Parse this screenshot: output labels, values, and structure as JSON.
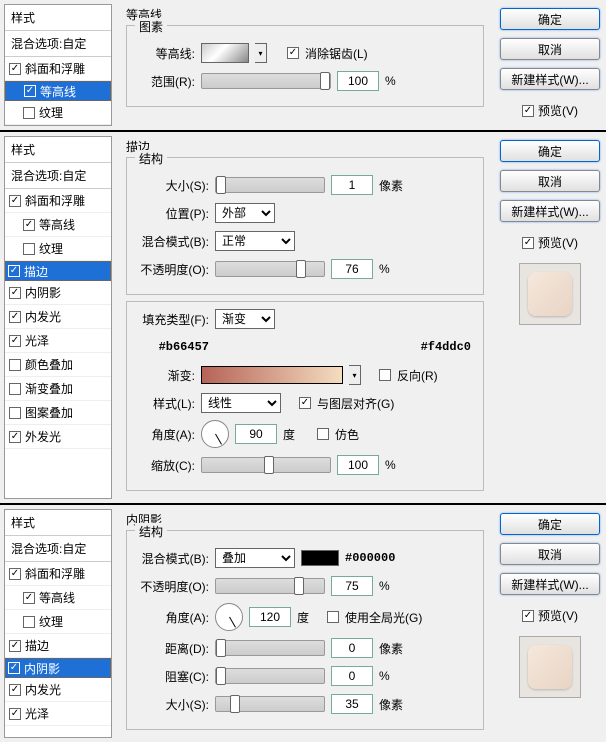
{
  "panel1": {
    "styleTitle": "样式",
    "blendOpt": "混合选项:自定",
    "s1": "斜面和浮雕",
    "s2": "等高线",
    "s3": "纹理",
    "mainTitle": "等高线",
    "group1": "图素",
    "contourLbl": "等高线:",
    "antiAlias": "消除锯齿(L)",
    "rangeLbl": "范围(R):",
    "rangeVal": "100",
    "pct": "%",
    "ok": "确定",
    "cancel": "取消",
    "newStyle": "新建样式(W)...",
    "preview": "预览(V)"
  },
  "panel2": {
    "styleTitle": "样式",
    "blendOpt": "混合选项:自定",
    "s1": "斜面和浮雕",
    "s2": "等高线",
    "s3": "纹理",
    "s4": "描边",
    "s5": "内阴影",
    "s6": "内发光",
    "s7": "光泽",
    "s8": "颜色叠加",
    "s9": "渐变叠加",
    "s10": "图案叠加",
    "s11": "外发光",
    "mainTitle": "描边",
    "group1": "结构",
    "sizeLbl": "大小(S):",
    "sizeVal": "1",
    "px": "像素",
    "posLbl": "位置(P):",
    "posVal": "外部",
    "blendLbl": "混合模式(B):",
    "blendVal": "正常",
    "opacLbl": "不透明度(O):",
    "opacVal": "76",
    "pct": "%",
    "fillLbl": "填充类型(F):",
    "fillVal": "渐变",
    "hex1": "#b66457",
    "hex2": "#f4ddc0",
    "gradLbl": "渐变:",
    "reverse": "反向(R)",
    "styleLbl": "样式(L):",
    "styleVal": "线性",
    "align": "与图层对齐(G)",
    "angleLbl": "角度(A):",
    "angleVal": "90",
    "deg": "度",
    "dither": "仿色",
    "scaleLbl": "缩放(C):",
    "scaleVal": "100",
    "ok": "确定",
    "cancel": "取消",
    "newStyle": "新建样式(W)...",
    "preview": "预览(V)"
  },
  "panel3": {
    "styleTitle": "样式",
    "blendOpt": "混合选项:自定",
    "s1": "斜面和浮雕",
    "s2": "等高线",
    "s3": "纹理",
    "s4": "描边",
    "s5": "内阴影",
    "s6": "内发光",
    "s7": "光泽",
    "mainTitle": "内阴影",
    "group1": "结构",
    "blendLbl": "混合模式(B):",
    "blendVal": "叠加",
    "hex": "#000000",
    "opacLbl": "不透明度(O):",
    "opacVal": "75",
    "pct": "%",
    "angleLbl": "角度(A):",
    "angleVal": "120",
    "deg": "度",
    "global": "使用全局光(G)",
    "distLbl": "距离(D):",
    "distVal": "0",
    "px": "像素",
    "chokeLbl": "阻塞(C):",
    "chokeVal": "0",
    "sizeLbl": "大小(S):",
    "sizeVal": "35",
    "ok": "确定",
    "cancel": "取消",
    "newStyle": "新建样式(W)...",
    "preview": "预览(V)"
  },
  "chart_data": null
}
